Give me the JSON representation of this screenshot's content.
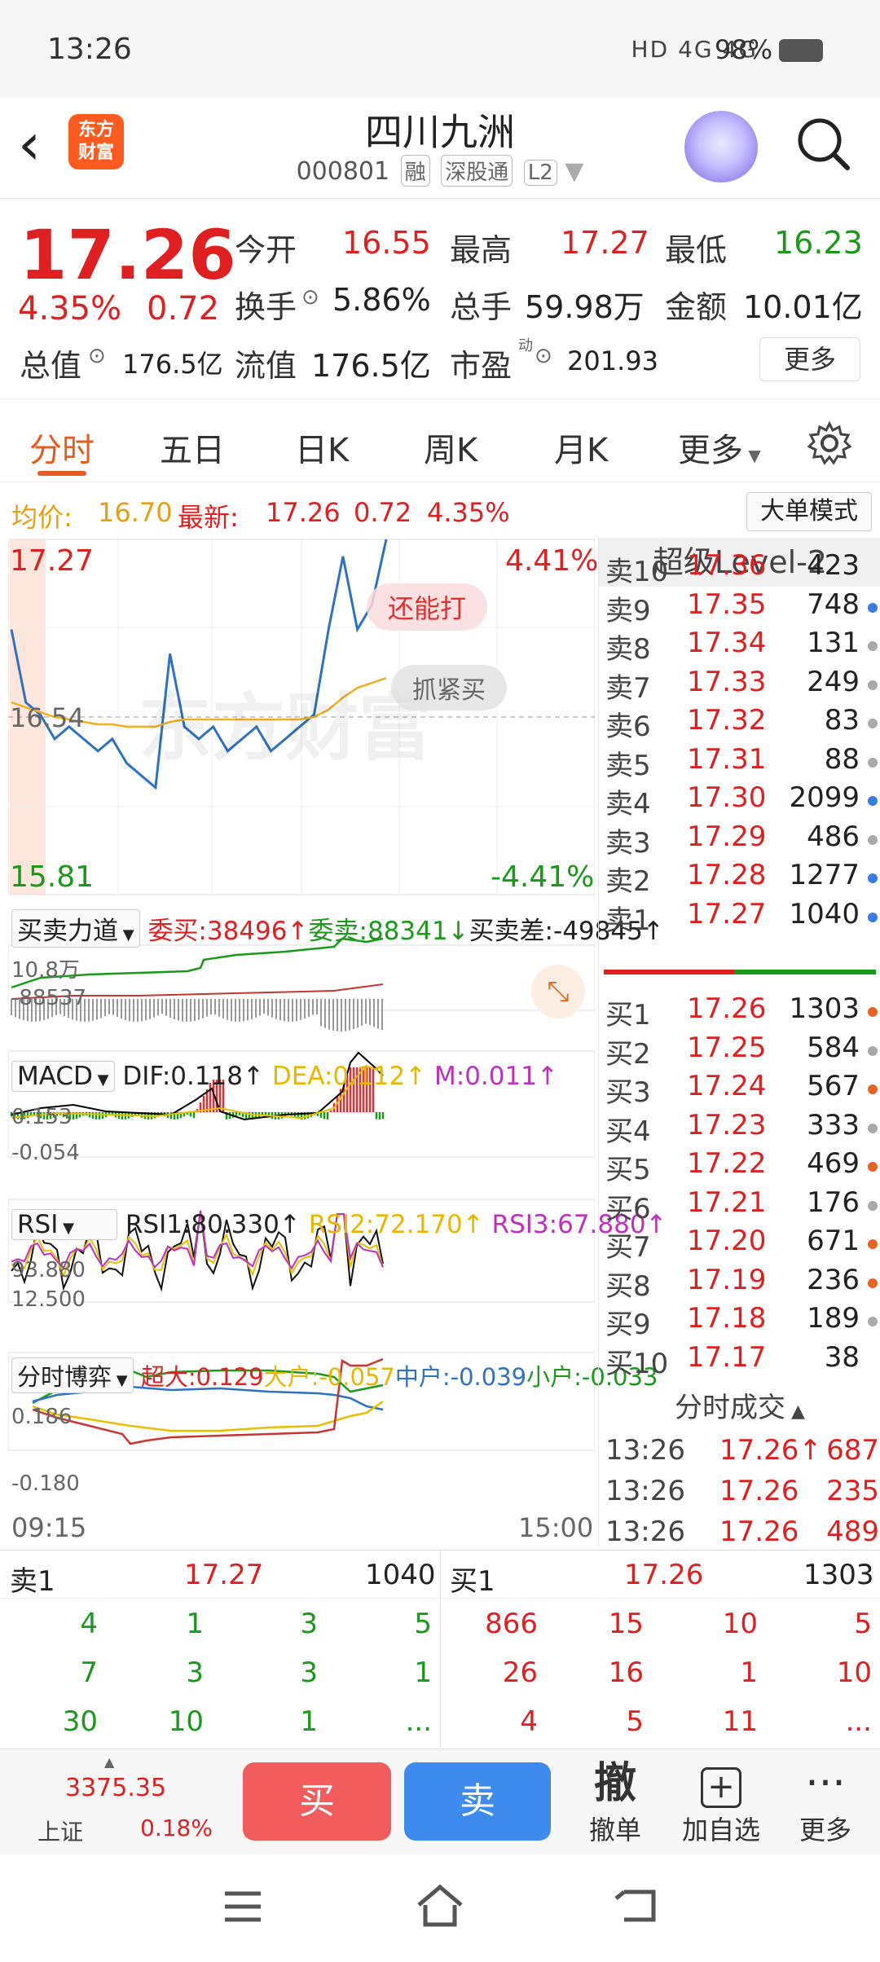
{
  "status_bar": {
    "time": "13:26",
    "network": "HD 4G 4G",
    "battery": "98%"
  },
  "header": {
    "logo_text": "东方\n财富",
    "title": "四川九洲",
    "code": "000801",
    "tags": [
      "融",
      "深股通",
      "L2"
    ]
  },
  "quote": {
    "price": "17.26",
    "change_pct": "4.35%",
    "change": "0.72",
    "labels": {
      "open": "今开",
      "high": "最高",
      "low": "最低",
      "turnover": "换手",
      "volume": "总手",
      "amount": "金额",
      "total_cap": "总值",
      "float_cap": "流值",
      "pe": "市盈",
      "pe_sup": "动"
    },
    "open": "16.55",
    "high": "17.27",
    "low": "16.23",
    "turnover": "5.86%",
    "volume": "59.98万",
    "amount": "10.01亿",
    "total_cap": "176.5亿",
    "float_cap": "176.5亿",
    "pe": "201.93",
    "more_label": "更多"
  },
  "tabs": [
    "分时",
    "五日",
    "日K",
    "周K",
    "月K",
    "更多"
  ],
  "avg_bar": {
    "avg_label": "均价:",
    "avg": "16.70",
    "latest_label": "最新:",
    "latest": "17.26",
    "chg": "0.72",
    "pct": "4.35%",
    "mode_btn": "大单模式"
  },
  "main_chart": {
    "y_top": "17.27",
    "y_mid": "16.54",
    "y_bottom": "15.81",
    "pct_top": "4.41%",
    "pct_bottom": "-4.41%",
    "popup1": "还能打",
    "popup2": "抓紧买",
    "watermark": "东方财富"
  },
  "ind1": {
    "name": "买卖力道",
    "buy_label": "委买:",
    "buy": "38496",
    "sell_label": "委卖:",
    "sell": "88341",
    "diff_label": "买卖差:",
    "diff": "-49845",
    "y_top": "10.8万",
    "y_bottom": "-88537"
  },
  "ind2": {
    "name": "MACD",
    "dif": "DIF:0.118",
    "dea": "DEA:0.112",
    "m": "M:0.011",
    "y_top": "0.153",
    "y_bottom": "-0.054"
  },
  "ind3": {
    "name": "RSI",
    "r1": "RSI1:80.330",
    "r2": "RSI2:72.170",
    "r3": "RSI3:67.880",
    "y_top": "93.880",
    "y_bottom": "12.500"
  },
  "ind4": {
    "name": "分时博弈",
    "sup": "超大:0.129",
    "big": "大户:-0.057",
    "mid": "中户:-0.039",
    "small": "小户:-0.033",
    "y_top": "0.186",
    "y_bottom": "-0.180"
  },
  "time_axis": {
    "start": "09:15",
    "end": "15:00"
  },
  "level2": {
    "title": "超级Level-2",
    "asks": [
      {
        "label": "卖10",
        "price": "17.36",
        "vol": "423",
        "dot": ""
      },
      {
        "label": "卖9",
        "price": "17.35",
        "vol": "748",
        "dot": "#3a7de0"
      },
      {
        "label": "卖8",
        "price": "17.34",
        "vol": "131",
        "dot": "#aaaaaa"
      },
      {
        "label": "卖7",
        "price": "17.33",
        "vol": "249",
        "dot": "#aaaaaa"
      },
      {
        "label": "卖6",
        "price": "17.32",
        "vol": "83",
        "dot": "#aaaaaa"
      },
      {
        "label": "卖5",
        "price": "17.31",
        "vol": "88",
        "dot": "#aaaaaa"
      },
      {
        "label": "卖4",
        "price": "17.30",
        "vol": "2099",
        "dot": "#3a7de0"
      },
      {
        "label": "卖3",
        "price": "17.29",
        "vol": "486",
        "dot": "#aaaaaa"
      },
      {
        "label": "卖2",
        "price": "17.28",
        "vol": "1277",
        "dot": "#3a7de0"
      },
      {
        "label": "卖1",
        "price": "17.27",
        "vol": "1040",
        "dot": "#3a7de0"
      }
    ],
    "bids": [
      {
        "label": "买1",
        "price": "17.26",
        "vol": "1303",
        "dot": "#e8641f"
      },
      {
        "label": "买2",
        "price": "17.25",
        "vol": "584",
        "dot": "#aaaaaa"
      },
      {
        "label": "买3",
        "price": "17.24",
        "vol": "567",
        "dot": "#e8641f"
      },
      {
        "label": "买4",
        "price": "17.23",
        "vol": "333",
        "dot": "#aaaaaa"
      },
      {
        "label": "买5",
        "price": "17.22",
        "vol": "469",
        "dot": "#e8641f"
      },
      {
        "label": "买6",
        "price": "17.21",
        "vol": "176",
        "dot": "#aaaaaa"
      },
      {
        "label": "买7",
        "price": "17.20",
        "vol": "671",
        "dot": "#e8641f"
      },
      {
        "label": "买8",
        "price": "17.19",
        "vol": "236",
        "dot": "#e8641f"
      },
      {
        "label": "买9",
        "price": "17.18",
        "vol": "189",
        "dot": "#aaaaaa"
      },
      {
        "label": "买10",
        "price": "17.17",
        "vol": "38",
        "dot": ""
      }
    ],
    "trades_title": "分时成交",
    "trades": [
      {
        "time": "13:26",
        "price": "17.26↑",
        "vol": "687"
      },
      {
        "time": "13:26",
        "price": "17.26",
        "vol": "235"
      },
      {
        "time": "13:26",
        "price": "17.26",
        "vol": "489"
      }
    ]
  },
  "bottom_queue": {
    "ask1_label": "卖1",
    "ask1_price": "17.27",
    "ask1_vol": "1040",
    "bid1_label": "买1",
    "bid1_price": "17.26",
    "bid1_vol": "1303",
    "ask_rows": [
      [
        "4",
        "1",
        "3",
        "5"
      ],
      [
        "7",
        "3",
        "3",
        "1"
      ],
      [
        "30",
        "10",
        "1",
        "..."
      ]
    ],
    "bid_rows": [
      [
        "866",
        "15",
        "10",
        "5"
      ],
      [
        "26",
        "16",
        "1",
        "10"
      ],
      [
        "4",
        "5",
        "11",
        "..."
      ]
    ]
  },
  "toolbar": {
    "index_value": "3375.35",
    "index_name": "上证",
    "index_pct": "0.18%",
    "buy": "买",
    "sell": "卖",
    "cancel_icon": "撤",
    "cancel": "撤单",
    "add_watch": "加自选",
    "more": "更多"
  },
  "chart_data": {
    "type": "line",
    "x_range": [
      "09:15",
      "15:00"
    ],
    "ylim": [
      15.81,
      17.27
    ],
    "series": [
      {
        "name": "",
        "values": [
          16.9,
          16.6,
          16.55,
          16.45,
          16.5,
          16.45,
          16.4,
          16.45,
          16.35,
          16.3,
          16.25,
          16.8,
          16.5,
          16.45,
          16.5,
          16.4,
          16.45,
          16.5,
          16.4,
          16.45,
          16.5,
          16.55,
          16.9,
          17.2,
          16.9,
          17.0,
          17.27
        ]
      },
      {
        "name": "均价",
        "values": [
          16.6,
          16.58,
          16.56,
          16.54,
          16.53,
          16.52,
          16.51,
          16.51,
          16.5,
          16.5,
          16.5,
          16.52,
          16.53,
          16.53,
          16.53,
          16.53,
          16.53,
          16.53,
          16.53,
          16.53,
          16.53,
          16.54,
          16.57,
          16.62,
          16.66,
          16.68,
          16.7
        ]
      }
    ]
  }
}
